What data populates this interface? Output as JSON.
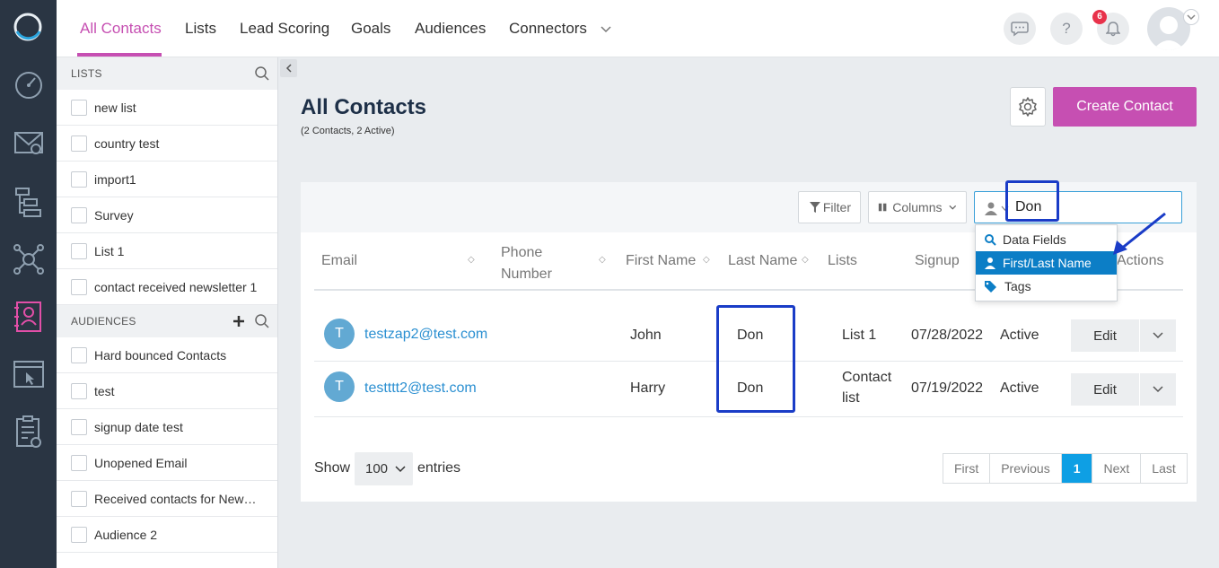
{
  "nav": {
    "tabs": [
      {
        "label": "All Contacts"
      },
      {
        "label": "Lists"
      },
      {
        "label": "Lead Scoring"
      },
      {
        "label": "Goals"
      },
      {
        "label": "Audiences"
      },
      {
        "label": "Connectors"
      }
    ],
    "notification_count": "6",
    "help_label": "?"
  },
  "lists_panel": {
    "lists_header": "LISTS",
    "lists": [
      "new list",
      "country test",
      "import1",
      "Survey",
      "List 1",
      "contact received newsletter 1"
    ],
    "audiences_header": "AUDIENCES",
    "audiences": [
      "Hard bounced Contacts",
      "test",
      "signup date test",
      "Unopened Email",
      "Received contacts for New…",
      "Audience 2"
    ]
  },
  "main": {
    "title": "All Contacts",
    "subtitle": "(2 Contacts, 2 Active)",
    "create_label": "Create Contact"
  },
  "toolbar": {
    "filter_label": "Filter",
    "columns_label": "Columns",
    "search_value": "Don"
  },
  "search_dropdown": {
    "items": [
      "Data Fields",
      "First/Last Name",
      "Tags"
    ],
    "selected": "First/Last Name"
  },
  "table": {
    "headers": [
      "Email",
      "Phone Number",
      "First Name",
      "Last Name",
      "Lists",
      "Signup",
      "Actions"
    ],
    "rows": [
      {
        "avatar": "T",
        "email": "testzap2@test.com",
        "first": "John",
        "last": "Don",
        "list": "List 1",
        "signup": "07/28/2022",
        "status": "Active",
        "edit": "Edit"
      },
      {
        "avatar": "T",
        "email": "testttt2@test.com",
        "first": "Harry",
        "last": "Don",
        "list_line1": "Contact",
        "list_line2": "list",
        "signup": "07/19/2022",
        "status": "Active",
        "edit": "Edit"
      }
    ]
  },
  "footer": {
    "show_label": "Show",
    "page_size": "100",
    "entries_label": "entries",
    "pager": {
      "first": "First",
      "previous": "Previous",
      "current": "1",
      "next": "Next",
      "last": "Last"
    }
  },
  "colors": {
    "accent": "#c64fb2",
    "link": "#2a8fd1",
    "highlight": "#1a3cc7",
    "selected": "#0c7ec6"
  }
}
